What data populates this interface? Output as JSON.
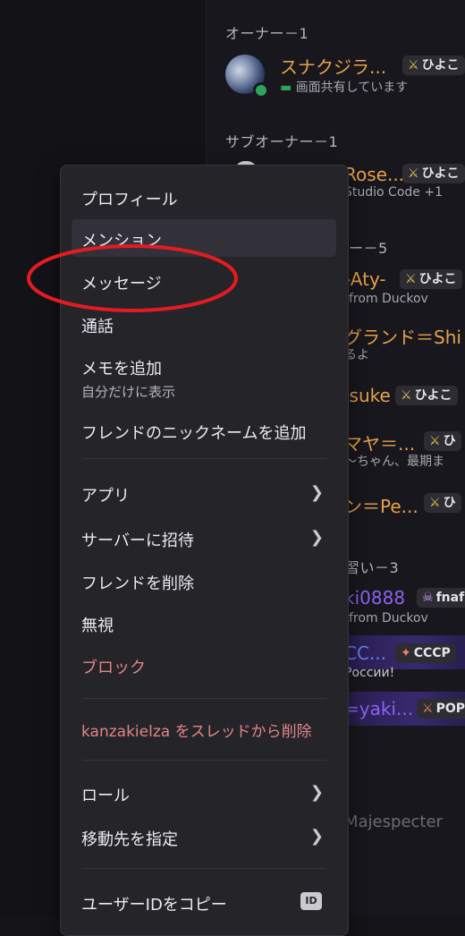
{
  "member_list": {
    "groups": [
      {
        "heading": "オーナー－1"
      },
      {
        "heading": "サブオーナー－1"
      },
      {
        "heading": "ー－5"
      },
      {
        "heading": "習い－3"
      }
    ],
    "members": [
      {
        "name": "スナクジラ...",
        "tag": "ひよこ",
        "status": "画面共有しています",
        "name_color": "#e7a24a"
      },
      {
        "name": "Rose...",
        "tag": "ひよこ",
        "status": "Studio Code +1",
        "name_color": "#e7a24a"
      },
      {
        "name": "-Aty-",
        "tag": "ひよこ",
        "status": "from Duckov",
        "name_color": "#e7a24a"
      },
      {
        "name": "グランド＝Shi",
        "tag": "",
        "status": "るよ",
        "name_color": "#e7a24a"
      },
      {
        "name": "lsuke",
        "tag": "ひよこ",
        "status": "",
        "name_color": "#e7a24a"
      },
      {
        "name": "マヤ＝...",
        "tag": "ひ",
        "status": "～ちゃん、最期ま",
        "name_color": "#e7a24a"
      },
      {
        "name": "ン＝Pe...",
        "tag": "ひ",
        "status": "",
        "name_color": "#e7a24a"
      },
      {
        "name": "ki0888",
        "tag": "fnaf",
        "status": "from Duckov",
        "name_color": "#8e62f0"
      },
      {
        "name": "CC...",
        "tag": "CCCP",
        "status": "России!",
        "name_color": "#6a7cf0"
      },
      {
        "name": "=yaki...",
        "tag": "POP",
        "status": "",
        "name_color": "#8e62f0"
      },
      {
        "name": "Majespecter",
        "tag": "",
        "status": "",
        "name_color": "#6c6c75"
      }
    ]
  },
  "context_menu": {
    "items": [
      {
        "label": "プロフィール"
      },
      {
        "label": "メンション"
      },
      {
        "label": "メッセージ"
      },
      {
        "label": "通話"
      },
      {
        "label": "メモを追加",
        "hint": "自分だけに表示"
      },
      {
        "label": "フレンドのニックネームを追加"
      },
      {
        "label": "アプリ"
      },
      {
        "label": "サーバーに招待"
      },
      {
        "label": "フレンドを削除"
      },
      {
        "label": "無視"
      },
      {
        "label": "ブロック"
      },
      {
        "label": "kanzakielza をスレッドから削除"
      },
      {
        "label": "ロール"
      },
      {
        "label": "移動先を指定"
      },
      {
        "label": "ユーザーIDをコピー",
        "badge": "ID"
      }
    ]
  },
  "colors": {
    "danger": "#e0868a",
    "annotation": "#e31b23",
    "online": "#2ea35e"
  },
  "icons": {
    "chevron": "chevron-right-icon",
    "tag": "sword-icon",
    "id": "id-icon"
  }
}
